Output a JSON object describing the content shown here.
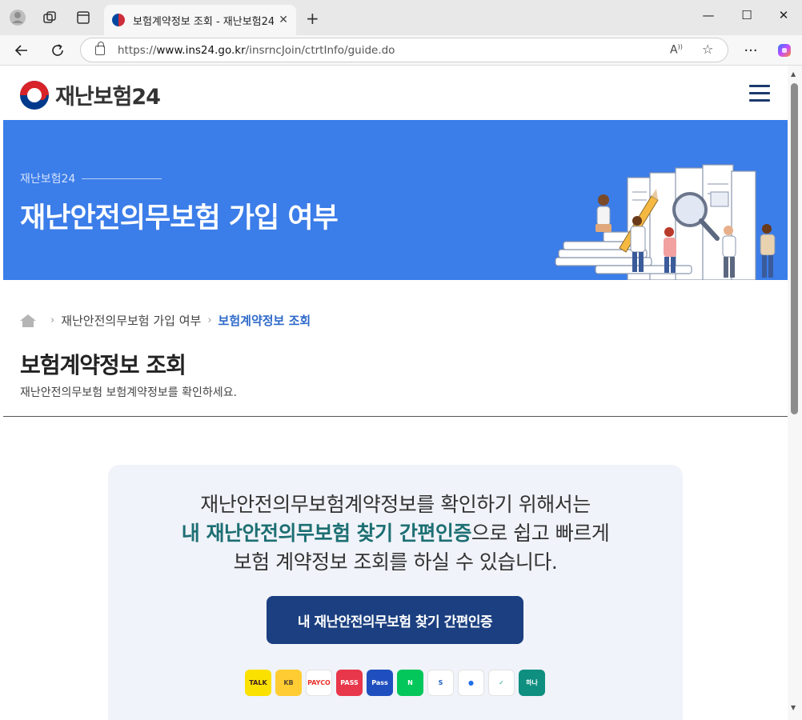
{
  "browser": {
    "tab_title": "보험계약정보 조회 - 재난보험24",
    "tab_close": "✕",
    "new_tab": "+",
    "url_scheme": "https://",
    "url_host": "www.ins24.go.kr",
    "url_path": "/insrncJoin/ctrtInfo/guide.do"
  },
  "site": {
    "logo_text": "재난보험24"
  },
  "banner": {
    "small_title": "재난보험24",
    "big_title": "재난안전의무보험 가입 여부"
  },
  "breadcrumb": {
    "item1": "재난안전의무보험 가입 여부",
    "item2": "보험계약정보 조회"
  },
  "page": {
    "title": "보험계약정보 조회",
    "subtitle": "재난안전의무보험 보험계약정보를 확인하세요."
  },
  "card": {
    "line1": "재난안전의무보험계약정보를 확인하기 위해서는",
    "line2_highlight": "내 재난안전의무보험 찾기 간편인증",
    "line2_rest": "으로 쉽고 빠르게",
    "line3": "보험 계약정보 조회를 하실 수 있습니다.",
    "cta": "내 재난안전의무보험 찾기 간편인증"
  },
  "providers": [
    {
      "label": "TALK",
      "bg": "#fae100",
      "fg": "#3c1e1e"
    },
    {
      "label": "KB",
      "bg": "#ffcc33",
      "fg": "#5a4a2a"
    },
    {
      "label": "PAYCO",
      "bg": "#ffffff",
      "fg": "#e8312b"
    },
    {
      "label": "PASS",
      "bg": "#e8364a",
      "fg": "#ffffff"
    },
    {
      "label": "Pass",
      "bg": "#1f4fbf",
      "fg": "#ffffff"
    },
    {
      "label": "N",
      "bg": "#03c75a",
      "fg": "#ffffff"
    },
    {
      "label": "S",
      "bg": "#ffffff",
      "fg": "#1f5fbf"
    },
    {
      "label": "●",
      "bg": "#ffffff",
      "fg": "#1e6fe8"
    },
    {
      "label": "✓",
      "bg": "#ffffff",
      "fg": "#1aa88e"
    },
    {
      "label": "하나",
      "bg": "#0e8f80",
      "fg": "#ffffff"
    }
  ]
}
